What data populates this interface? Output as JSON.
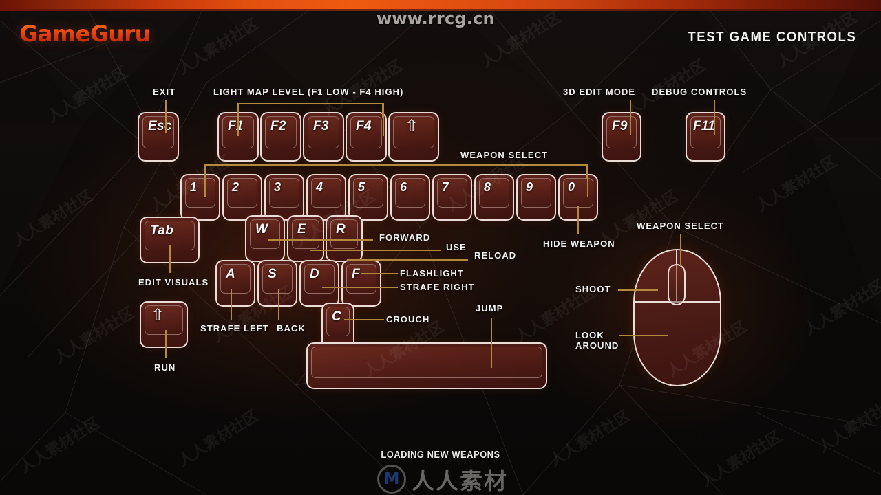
{
  "brand": {
    "name": "GameGuru",
    "accent": "#ef5a10"
  },
  "header": {
    "title": "TEST GAME CONTROLS"
  },
  "watermarks": {
    "url": "www.rrcg.cn",
    "logo_mark": "M",
    "logo_text": "人人素材",
    "tile_text": "人人素材社区"
  },
  "status": {
    "text": "LOADING NEW WEAPONS"
  },
  "theme": {
    "key_fill": "#4a1a14",
    "key_border": "#ecdcd8",
    "leader_line": "#b38a3c",
    "label_text": "#f6f4f3",
    "background": "#0a0908"
  },
  "keyboard": {
    "function_row": [
      {
        "key": "esc",
        "label": "Esc",
        "type": "text"
      },
      {
        "key": "f1",
        "label": "F1",
        "type": "text"
      },
      {
        "key": "f2",
        "label": "F2",
        "type": "text"
      },
      {
        "key": "f3",
        "label": "F3",
        "type": "text"
      },
      {
        "key": "f4",
        "label": "F4",
        "type": "text"
      },
      {
        "key": "shift-top",
        "label": "⇧",
        "type": "glyph"
      },
      {
        "key": "f9",
        "label": "F9",
        "type": "text"
      },
      {
        "key": "f11",
        "label": "F11",
        "type": "text"
      }
    ],
    "number_row": [
      {
        "key": "1",
        "label": "1"
      },
      {
        "key": "2",
        "label": "2"
      },
      {
        "key": "3",
        "label": "3"
      },
      {
        "key": "4",
        "label": "4"
      },
      {
        "key": "5",
        "label": "5"
      },
      {
        "key": "6",
        "label": "6"
      },
      {
        "key": "7",
        "label": "7"
      },
      {
        "key": "8",
        "label": "8"
      },
      {
        "key": "9",
        "label": "9"
      },
      {
        "key": "0",
        "label": "0"
      }
    ],
    "letter_keys": [
      {
        "key": "tab",
        "label": "Tab"
      },
      {
        "key": "w",
        "label": "W"
      },
      {
        "key": "e",
        "label": "E"
      },
      {
        "key": "r",
        "label": "R"
      },
      {
        "key": "a",
        "label": "A"
      },
      {
        "key": "s",
        "label": "S"
      },
      {
        "key": "d",
        "label": "D"
      },
      {
        "key": "f",
        "label": "F"
      },
      {
        "key": "c",
        "label": "C"
      },
      {
        "key": "shift-left",
        "label": "⇧"
      },
      {
        "key": "space",
        "label": ""
      }
    ]
  },
  "callouts": {
    "exit": "EXIT",
    "light_map_level": "LIGHT MAP LEVEL (F1 LOW - F4 HIGH)",
    "edit_mode_3d": "3D EDIT MODE",
    "debug_controls": "DEBUG CONTROLS",
    "weapon_select_keyboard": "WEAPON SELECT",
    "hide_weapon": "HIDE WEAPON",
    "forward": "FORWARD",
    "use": "USE",
    "reload": "RELOAD",
    "flashlight": "FLASHLIGHT",
    "strafe_right": "STRAFE RIGHT",
    "edit_visuals": "EDIT VISUALS",
    "strafe_left": "STRAFE LEFT",
    "back": "BACK",
    "crouch": "CROUCH",
    "jump": "JUMP",
    "run": "RUN",
    "weapon_select_mouse": "WEAPON SELECT",
    "shoot": "SHOOT",
    "look_around": "LOOK\nAROUND"
  }
}
